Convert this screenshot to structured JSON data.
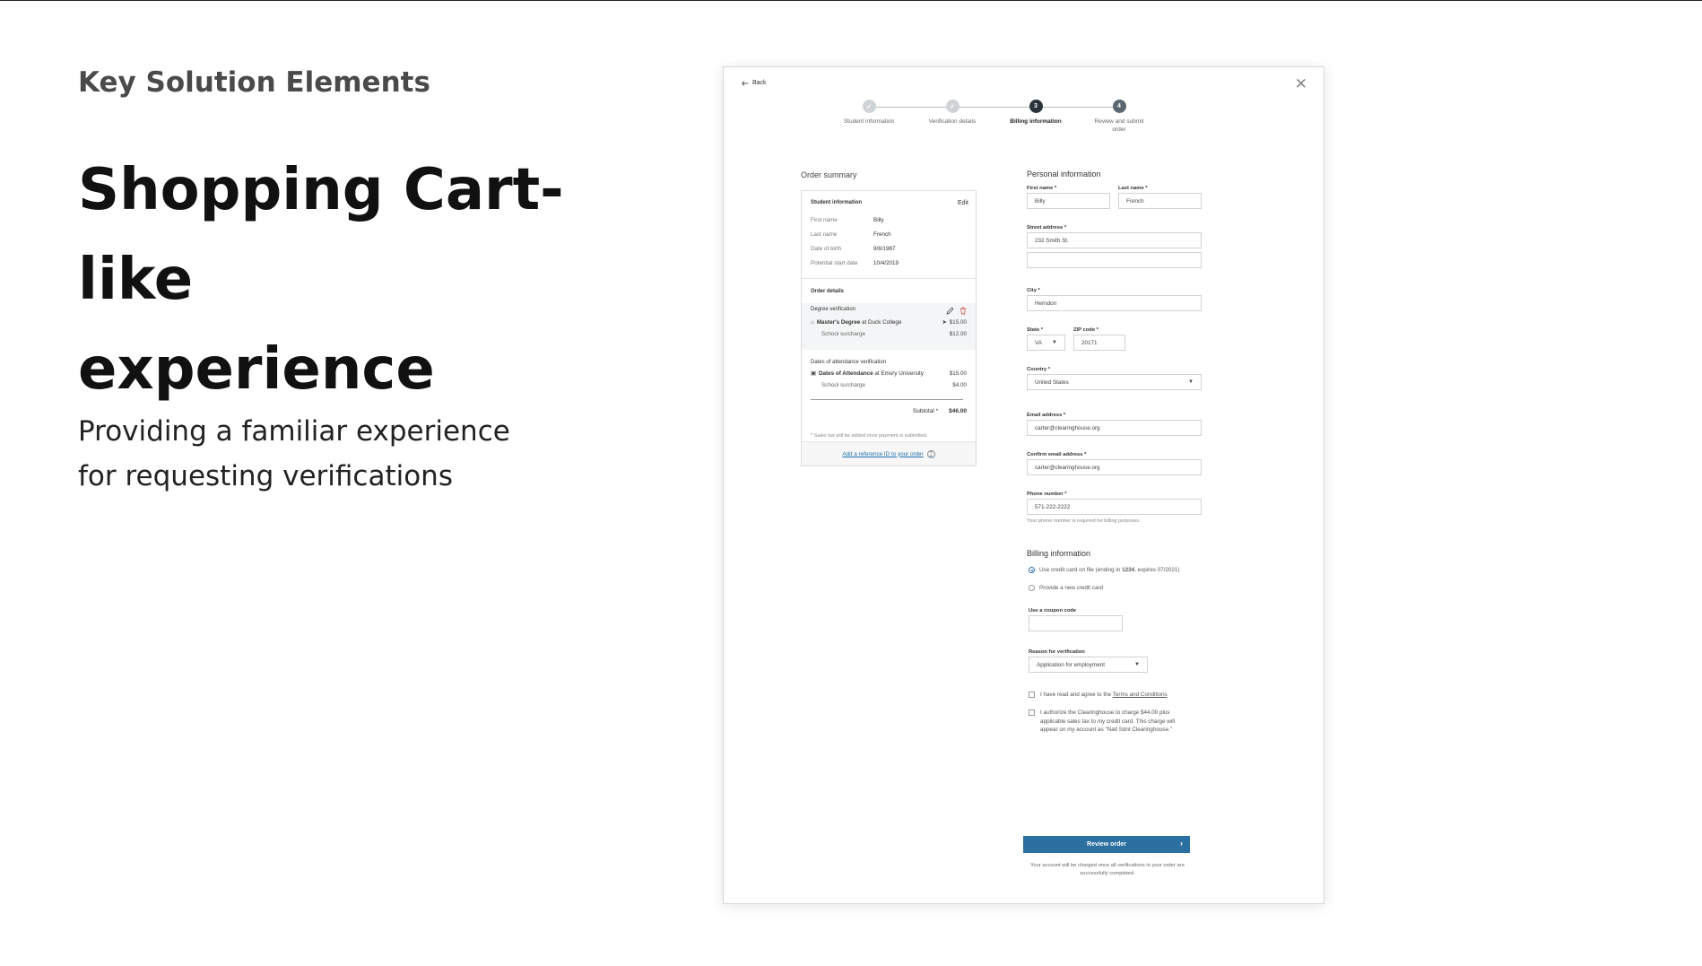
{
  "slide": {
    "kicker": "Key Solution Elements",
    "headline_line1": "Shopping Cart-like",
    "headline_line2": "experience",
    "sub_line1": "Providing a familiar experience",
    "sub_line2": "for requesting verifications"
  },
  "mockup": {
    "back_label": "Back",
    "close_glyph": "✕",
    "steps": [
      {
        "label": "Student information",
        "state": "done",
        "number": ""
      },
      {
        "label": "Verification details",
        "state": "done",
        "number": ""
      },
      {
        "label": "Billing information",
        "state": "current",
        "number": "3"
      },
      {
        "label": "Review and submit order",
        "state": "next",
        "number": "4"
      }
    ],
    "order_summary": {
      "title": "Order summary",
      "student_title": "Student information",
      "edit_label": "Edit",
      "student_fields": [
        {
          "k": "First name",
          "v": "Billy"
        },
        {
          "k": "Last name",
          "v": "French"
        },
        {
          "k": "Date of birth",
          "v": "9/8/1987"
        },
        {
          "k": "Potential start date",
          "v": "10/4/2019"
        }
      ],
      "order_details_title": "Order details",
      "degree_section": "Degree verification",
      "degree_item": {
        "strong": "Master's Degree",
        "rest": " at Duck College",
        "price": "$15.00"
      },
      "degree_surcharge": {
        "label": "School surcharge",
        "price": "$12.00"
      },
      "attendance_section": "Dates of attendance verification",
      "attendance_item": {
        "strong": "Dates of Attendance",
        "rest": " at Emory University",
        "price": "$15.00"
      },
      "attendance_surcharge": {
        "label": "School surcharge",
        "price": "$4.00"
      },
      "subtotal_label": "Subtotal *",
      "subtotal_value": "$46.00",
      "tax_note": "* Sales tax will be added once payment is submitted.",
      "reference_link": "Add a reference ID to your order"
    },
    "personal": {
      "title": "Personal information",
      "first_name_label": "First name *",
      "first_name": "Billy",
      "last_name_label": "Last name *",
      "last_name": "French",
      "street_label": "Street address *",
      "street": "232 Smith St.",
      "street2": "",
      "city_label": "City *",
      "city": "Herndon",
      "state_label": "State *",
      "state": "VA",
      "zip_label": "ZIP code *",
      "zip": "20171",
      "country_label": "Country *",
      "country": "United States",
      "email_label": "Email address *",
      "email": "carter@clearinghouse.org",
      "confirm_email_label": "Confirm email address *",
      "confirm_email": "carter@clearinghouse.org",
      "phone_label": "Phone number *",
      "phone": "571-222-2222",
      "phone_help": "Your phone number is required for billing purposes."
    },
    "billing": {
      "title": "Billing information",
      "option_on_file_pre": "Use credit card on file (ending in ",
      "option_on_file_num": "1234",
      "option_on_file_post": ", expires 07/2021)",
      "option_new": "Provide a new credit card",
      "coupon_label": "Use a coupon code",
      "coupon_value": "",
      "reason_label": "Reason for verification",
      "reason_value": "Application for employment",
      "terms_pre": "I have read and agree to the ",
      "terms_link": "Terms and Conditions",
      "authorize": "I authorize the Clearinghouse to charge $44.00 plus applicable sales tax to my credit card. This charge will appear on my account as \"Natl Sdnt Clearinghouse.\"",
      "cta_label": "Review order",
      "cta_note": "Your account will be charged once all verifications in your order are successfully completed."
    }
  }
}
